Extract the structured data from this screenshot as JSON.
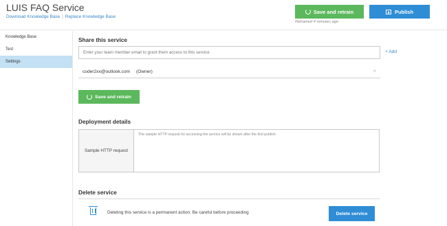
{
  "header": {
    "title": "LUIS FAQ Service",
    "links": [
      "Download Knowledge Base",
      "Replace Knowledge Base"
    ],
    "separator": "|",
    "save_label": "Save and retrain",
    "retrained_text": "Retrained 4 minutes ago",
    "publish_label": "Publish"
  },
  "sidebar": {
    "items": [
      {
        "label": "Knowledge Base",
        "active": false
      },
      {
        "label": "Test",
        "active": false
      },
      {
        "label": "Settings",
        "active": true
      }
    ]
  },
  "share": {
    "title": "Share this service",
    "placeholder": "Enter your team member email to grant them access to this service",
    "add_label": "+ Add",
    "owner_email": "coder2xx@outlook.com",
    "owner_role": "(Owner)",
    "remove_glyph": "×",
    "save_label": "Save and retrain"
  },
  "deployment": {
    "title": "Deployment details",
    "row_label": "Sample HTTP request",
    "row_text": "The sample HTTP request for accessing the service will be shown after the first publish"
  },
  "delete": {
    "title": "Delete service",
    "warning": "Deleting this service is a permanent action. Be careful before proceeding",
    "button_label": "Delete service"
  },
  "colors": {
    "green": "#5cb85c",
    "blue": "#2f8dd6",
    "link": "#3a86c8",
    "active_nav": "#c3e0f4"
  }
}
